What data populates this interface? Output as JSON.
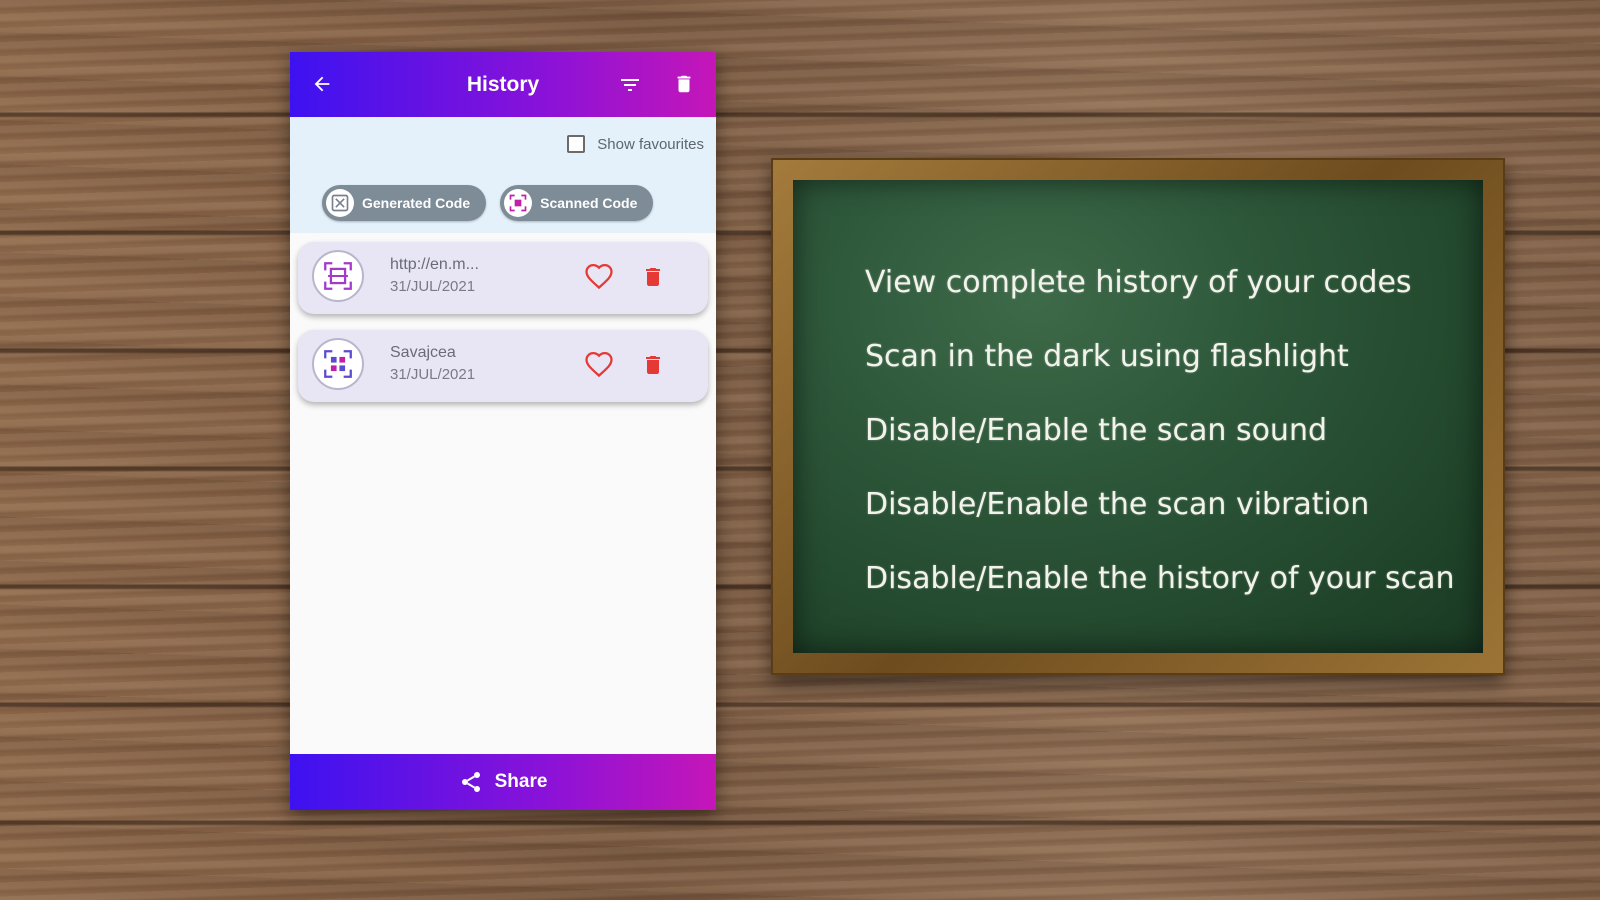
{
  "appbar": {
    "title": "History",
    "back_icon": "arrow-left-icon",
    "filter_icon": "filter-icon",
    "delete_icon": "trash-icon"
  },
  "filters": {
    "show_favourites_label": "Show favourites",
    "show_favourites_checked": false,
    "chips": [
      {
        "label": "Generated Code",
        "icon": "generated-code-icon"
      },
      {
        "label": "Scanned Code",
        "icon": "scanned-code-icon"
      }
    ]
  },
  "history": [
    {
      "name": "http://en.m...",
      "date": "31/JUL/2021",
      "icon": "qr-frame-icon"
    },
    {
      "name": "Savajcea",
      "date": "31/JUL/2021",
      "icon": "qr-scan-icon"
    }
  ],
  "bottombar": {
    "share_label": "Share",
    "share_icon": "share-icon"
  },
  "features": [
    "View complete history of your codes",
    "Scan in the dark using flashlight",
    "Disable/Enable the scan sound",
    "Disable/Enable the scan vibration",
    "Disable/Enable the history of your scan"
  ],
  "colors": {
    "gradient_start": "#3d12f0",
    "gradient_end": "#c516b8",
    "heart": "#e53935",
    "delete": "#e53935",
    "chalkboard": "#2c5538"
  }
}
